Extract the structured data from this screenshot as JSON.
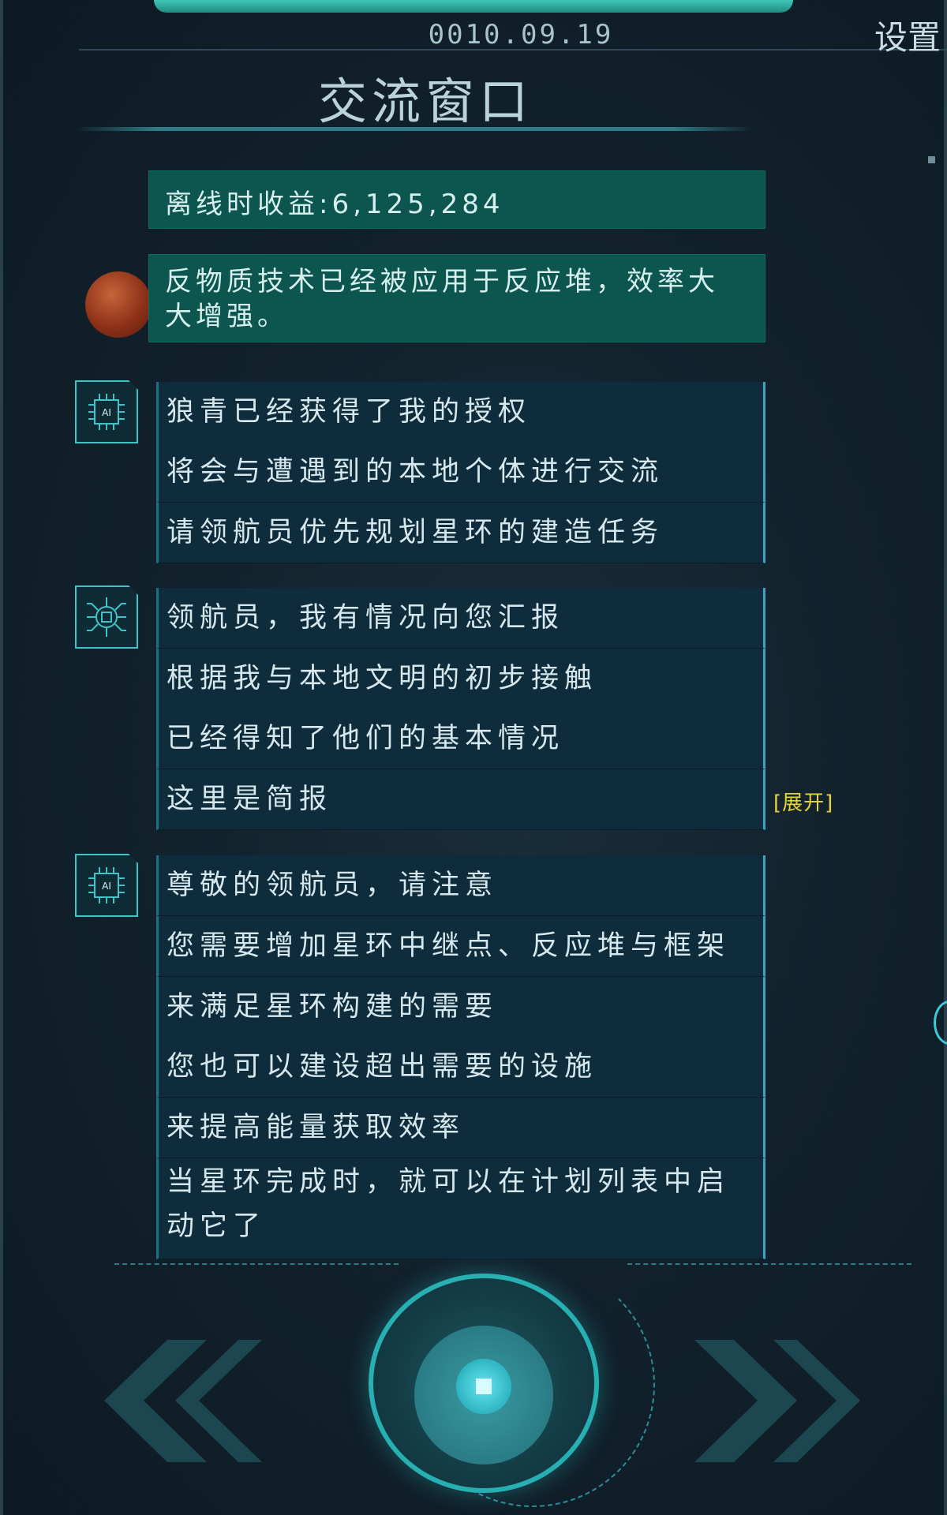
{
  "header": {
    "date": "0010.09.19",
    "settings_label": "设置",
    "title": "交流窗口"
  },
  "offline_income": "离线时收益:6,125,284",
  "notice": "反物质技术已经被应用于反应堆，效率大大增强。",
  "groups": [
    {
      "avatar": "ai-chip-icon",
      "lines": [
        "狼青已经获得了我的授权",
        "将会与遭遇到的本地个体进行交流",
        "请领航员优先规划星环的建造任务"
      ]
    },
    {
      "avatar": "circuit-bug-icon",
      "lines": [
        "领航员，我有情况向您汇报",
        "根据我与本地文明的初步接触",
        "已经得知了他们的基本情况",
        "这里是简报"
      ],
      "expand_label": "[展开]"
    },
    {
      "avatar": "ai-chip-icon",
      "lines": [
        "尊敬的领航员，请注意",
        "您需要增加星环中继点、反应堆与框架",
        "来满足星环构建的需要",
        "您也可以建设超出需要的设施",
        "来提高能量获取效率",
        "当星环完成时，就可以在计划列表中启动它了"
      ]
    }
  ],
  "controls": {
    "prev_icon": "double-chevron-left-icon",
    "next_icon": "double-chevron-right-icon",
    "center_icon": "stop-square-icon"
  },
  "colors": {
    "accent": "#27b0b2",
    "highlight": "#e7d33c",
    "message_bg": "#0f2c3c",
    "notice_bg": "#0c564f"
  }
}
